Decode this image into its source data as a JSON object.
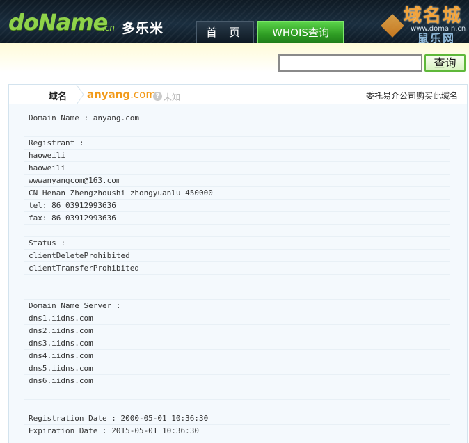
{
  "header": {
    "logo_text": "doName",
    "logo_suffix": ".cn",
    "brand_cn": "多乐米",
    "nav": [
      {
        "label": "首 页"
      },
      {
        "label": "WHOIS查询"
      }
    ],
    "watermark": {
      "title": "域名城",
      "url": "www.domain.cn",
      "subtitle": "鼠乐网"
    }
  },
  "search": {
    "value": "",
    "button_label": "查询"
  },
  "panel": {
    "domain_label": "域名",
    "domain_name": "anyang",
    "domain_tld": ".com",
    "status_icon": "?",
    "status_text": "未知",
    "buy_link": "委托易介公司购买此域名",
    "whois_lines": [
      "Domain Name : anyang.com",
      "",
      "Registrant :",
      "haoweili",
      "haoweili",
      "wwwanyangcom@163.com",
      "CN Henan Zhengzhoushi zhongyuanlu 450000",
      "tel: 86 03912993636",
      "fax: 86 03912993636",
      "",
      "Status :",
      "clientDeleteProhibited",
      "clientTransferProhibited",
      "",
      "",
      "Domain Name Server :",
      "dns1.iidns.com",
      "dns2.iidns.com",
      "dns3.iidns.com",
      "dns4.iidns.com",
      "dns5.iidns.com",
      "dns6.iidns.com",
      "",
      "",
      "Registration Date : 2000-05-01 10:36:30",
      "Expiration Date : 2015-05-01 10:36:30"
    ]
  }
}
